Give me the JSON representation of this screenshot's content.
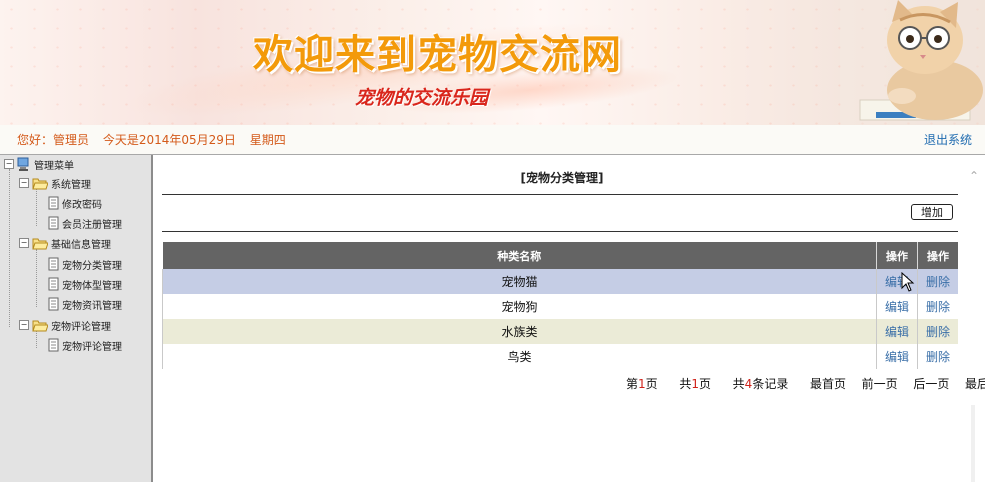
{
  "banner": {
    "title": "欢迎来到宠物交流网",
    "subtitle": "宠物的交流乐园"
  },
  "infobar": {
    "greeting": "您好：管理员",
    "date": "今天是2014年05月29日",
    "weekday": "星期四",
    "logout": "退出系统"
  },
  "sidebar": {
    "root": "管理菜单",
    "groups": [
      {
        "label": "系统管理",
        "items": [
          "修改密码",
          "会员注册管理"
        ]
      },
      {
        "label": "基础信息管理",
        "items": [
          "宠物分类管理",
          "宠物体型管理",
          "宠物资讯管理"
        ]
      },
      {
        "label": "宠物评论管理",
        "items": [
          "宠物评论管理"
        ]
      }
    ]
  },
  "main": {
    "heading": "[宠物分类管理]",
    "add_button": "增加",
    "columns": [
      "种类名称",
      "操作",
      "操作"
    ],
    "rows": [
      {
        "name": "宠物猫",
        "edit": "编辑",
        "delete": "删除"
      },
      {
        "name": "宠物狗",
        "edit": "编辑",
        "delete": "删除"
      },
      {
        "name": "水族类",
        "edit": "编辑",
        "delete": "删除"
      },
      {
        "name": "鸟类",
        "edit": "编辑",
        "delete": "删除"
      }
    ],
    "pager": {
      "page_prefix": "第",
      "page": "1",
      "page_suffix": "页",
      "total_prefix": "共",
      "total_pages": "1",
      "total_suffix": "页",
      "records_prefix": "共",
      "records": "4",
      "records_suffix": "条记录",
      "first": "最首页",
      "prev": "前一页",
      "next": "后一页",
      "last": "最后页"
    }
  },
  "colors": {
    "title_orange": "#f39a0a",
    "subtitle_red": "#d9261c",
    "greeting_orange": "#d45a1a",
    "link_blue": "#3a6fa8",
    "header_gray": "#646464",
    "selected_row": "#c5cde5",
    "alt_row": "#ebebd7"
  }
}
